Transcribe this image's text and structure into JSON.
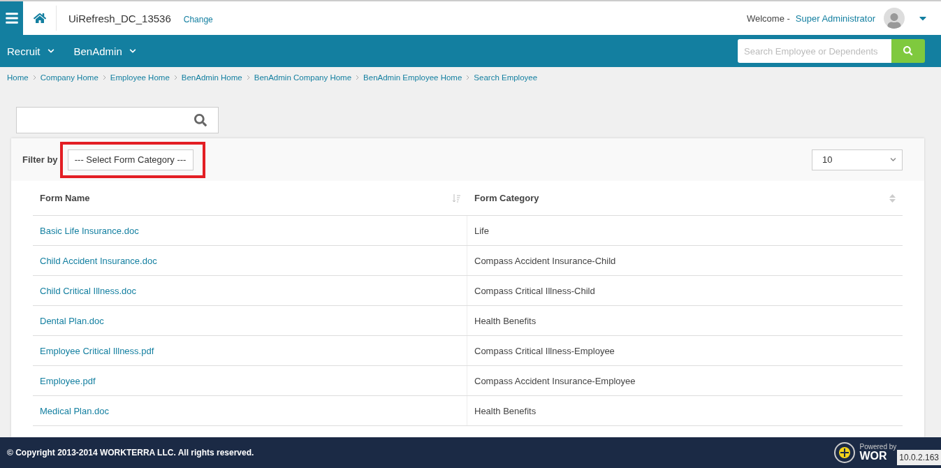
{
  "header": {
    "company": "UiRefresh_DC_13536",
    "change_link": "Change",
    "welcome": "Welcome -",
    "user": "Super Administrator"
  },
  "nav": {
    "menus": [
      {
        "label": "Recruit"
      },
      {
        "label": "BenAdmin"
      }
    ],
    "search": {
      "placeholder": "Search Employee or Dependents"
    }
  },
  "breadcrumb": [
    "Home",
    "Company Home",
    "Employee Home",
    "BenAdmin Home",
    "BenAdmin Company Home",
    "BenAdmin Employee Home",
    "Search Employee"
  ],
  "filter": {
    "label": "Filter by",
    "select": "--- Select Form Category ---",
    "highlighted": true,
    "page_size": "10"
  },
  "table": {
    "columns": [
      {
        "label": "Form Name",
        "sorted": true
      },
      {
        "label": "Form Category",
        "sorted": false
      }
    ],
    "rows": [
      {
        "name": "Basic Life Insurance.doc",
        "category": "Life"
      },
      {
        "name": "Child Accident Insurance.doc",
        "category": "Compass Accident Insurance-Child"
      },
      {
        "name": "Child Critical Illness.doc",
        "category": "Compass Critical Illness-Child"
      },
      {
        "name": "Dental Plan.doc",
        "category": "Health Benefits"
      },
      {
        "name": "Employee Critical Illness.pdf",
        "category": "Compass Critical Illness-Employee"
      },
      {
        "name": "Employee.pdf",
        "category": "Compass Accident Insurance-Employee"
      },
      {
        "name": "Medical Plan.doc",
        "category": "Health Benefits"
      }
    ]
  },
  "footer": {
    "copyright": "© Copyright 2013-2014 WORKTERRA LLC. All rights reserved.",
    "powered_by": "Powered by",
    "brand": "WOR",
    "version": "10.0.2.163"
  }
}
